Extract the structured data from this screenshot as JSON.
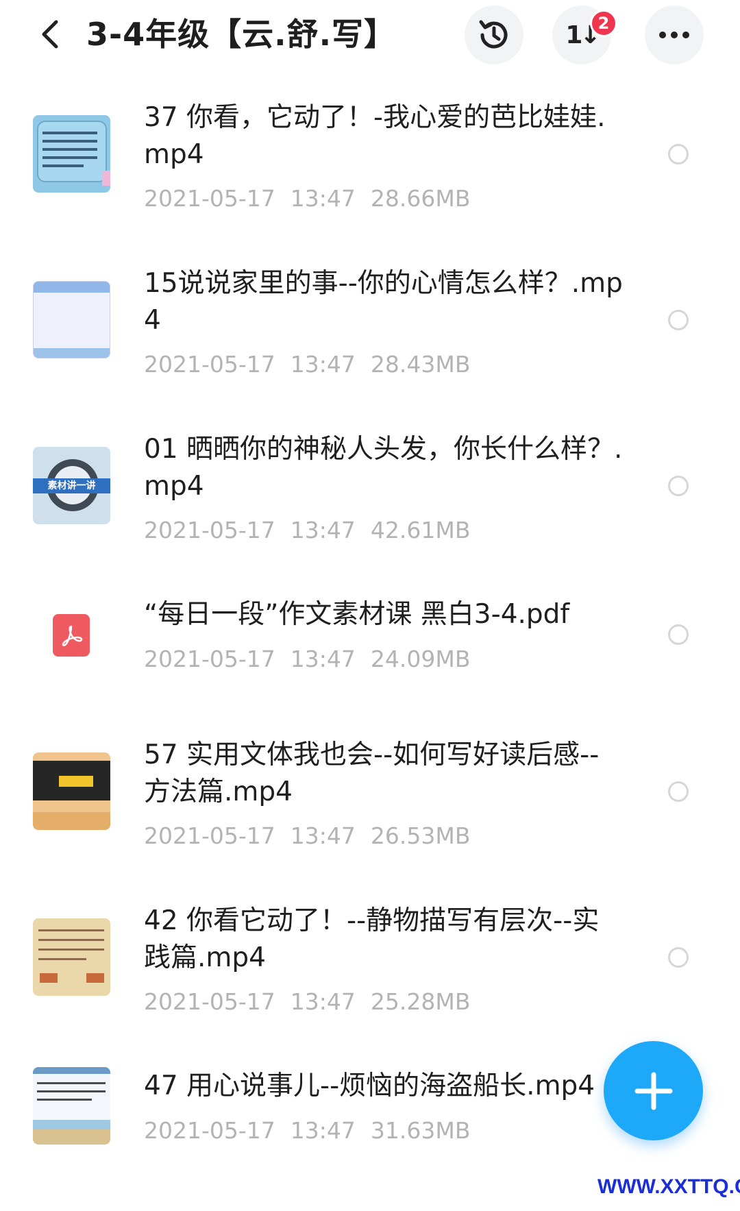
{
  "header": {
    "title": "3-4年级【云.舒.写】",
    "sort_label": "1↓",
    "sort_badge": "2"
  },
  "files": [
    {
      "name": "37  你看，它动了！-我心爱的芭比娃娃.mp4",
      "date": "2021-05-17",
      "time": "13:47",
      "size": "28.66MB",
      "icon": "video-thumbnail"
    },
    {
      "name": "15说说家里的事--你的心情怎么样？.mp4",
      "date": "2021-05-17",
      "time": "13:47",
      "size": "28.43MB",
      "icon": "video-thumbnail"
    },
    {
      "name": "01 晒晒你的神秘人头发，你长什么样？.mp4",
      "date": "2021-05-17",
      "time": "13:47",
      "size": "42.61MB",
      "icon": "video-thumbnail",
      "thumb_text": "素材讲一讲"
    },
    {
      "name": "“每日一段”作文素材课 黑白3-4.pdf",
      "date": "2021-05-17",
      "time": "13:47",
      "size": "24.09MB",
      "icon": "pdf-icon"
    },
    {
      "name": "57 实用文体我也会--如何写好读后感--方法篇.mp4",
      "date": "2021-05-17",
      "time": "13:47",
      "size": "26.53MB",
      "icon": "video-thumbnail"
    },
    {
      "name": "42 你看它动了！--静物描写有层次--实践篇.mp4",
      "date": "2021-05-17",
      "time": "13:47",
      "size": "25.28MB",
      "icon": "video-thumbnail"
    },
    {
      "name": "47  用心说事儿--烦恼的海盗船长.mp4",
      "date": "2021-05-17",
      "time": "13:47",
      "size": "31.63MB",
      "icon": "video-thumbnail"
    }
  ],
  "watermark": "WWW.XXTTQ.COM",
  "colors": {
    "accent": "#1ea8f8",
    "badge": "#f0364f",
    "meta": "#b3b3b3"
  }
}
